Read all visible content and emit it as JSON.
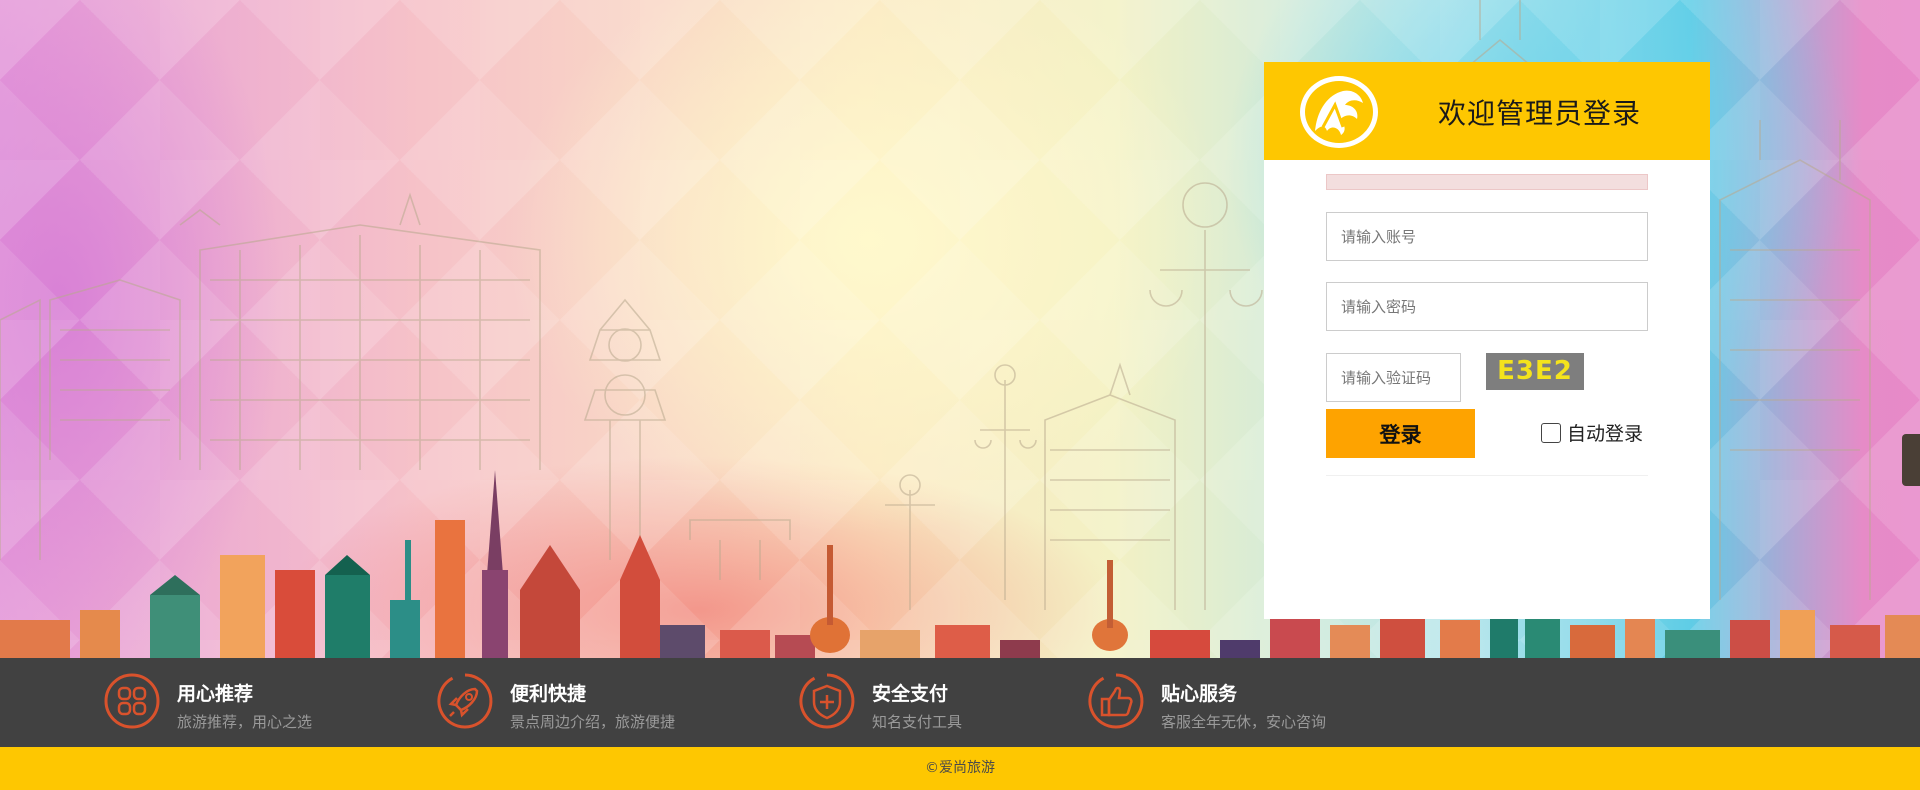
{
  "login": {
    "title": "欢迎管理员登录",
    "account_placeholder": "请输入账号",
    "password_placeholder": "请输入密码",
    "captcha_placeholder": "请输入验证码",
    "captcha_text": "E3E2",
    "login_button": "登录",
    "auto_login_label": "自动登录",
    "auto_login_checked": false
  },
  "features": [
    {
      "icon": "four-squares-icon",
      "title": "用心推荐",
      "desc": "旅游推荐，用心之选"
    },
    {
      "icon": "rocket-icon",
      "title": "便利快捷",
      "desc": "景点周边介绍，旅游便捷"
    },
    {
      "icon": "shield-icon",
      "title": "安全支付",
      "desc": "知名支付工具"
    },
    {
      "icon": "thumbs-up-icon",
      "title": "贴心服务",
      "desc": "客服全年无休，安心咨询"
    }
  ],
  "footer": {
    "copyright": "©爱尚旅游"
  },
  "colors": {
    "header_yellow": "#fec701",
    "login_button": "#fea300",
    "feature_bar": "#414141",
    "feature_icon": "#d9522c",
    "captcha_bg": "#7e7e7e",
    "captcha_text": "#f4e31c"
  }
}
